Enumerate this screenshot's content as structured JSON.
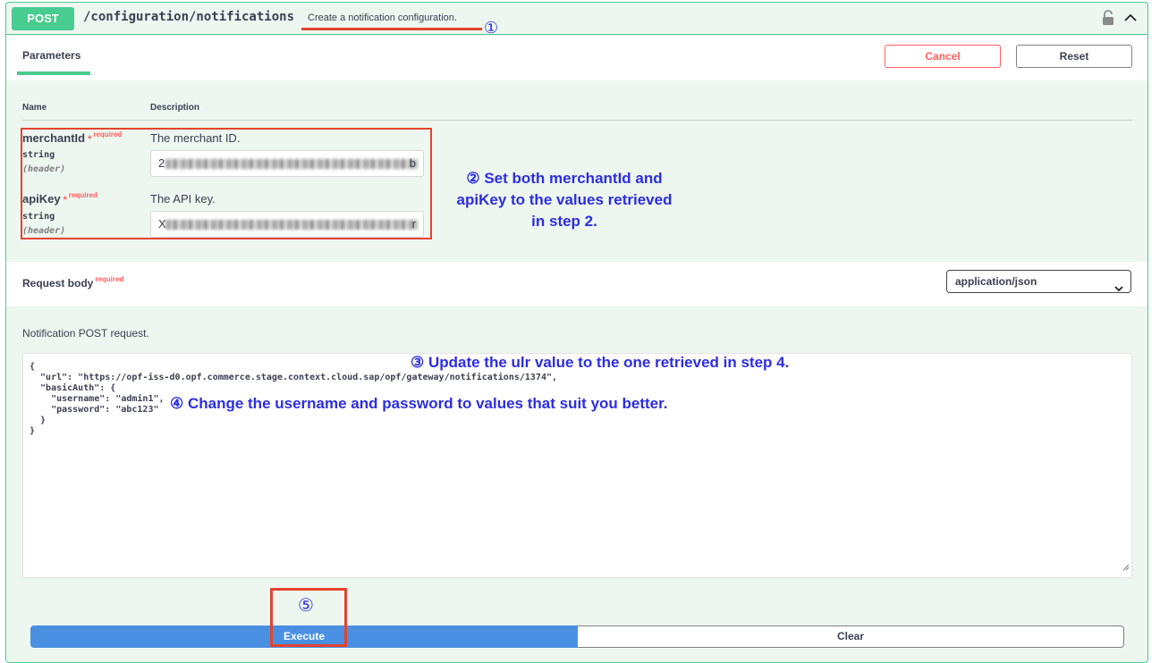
{
  "operation": {
    "method": "POST",
    "path": "/configuration/notifications",
    "summary": "Create a notification configuration."
  },
  "parameters_tab": {
    "label": "Parameters",
    "cancel_label": "Cancel",
    "reset_label": "Reset",
    "column_name": "Name",
    "column_description": "Description"
  },
  "params": [
    {
      "name": "merchantId",
      "required_star": "*",
      "required_label": "required",
      "type": "string",
      "in": "(header)",
      "description": "The merchant ID.",
      "value_start": "2",
      "value_end": "b"
    },
    {
      "name": "apiKey",
      "required_star": "*",
      "required_label": "required",
      "type": "string",
      "in": "(header)",
      "description": "The API key.",
      "value_start": "X",
      "value_end": "r"
    }
  ],
  "request_body": {
    "title": "Request body",
    "required_label": "required",
    "content_type": "application/json",
    "description": "Notification POST request.",
    "code_lines": [
      "{",
      "  \"url\": \"https://opf-iss-d0.opf.commerce.stage.context.cloud.sap/opf/gateway/notifications/1374\",",
      "  \"basicAuth\": {",
      "    \"username\": \"admin1\",",
      "    \"password\": \"abc123\"",
      "  }",
      "}"
    ]
  },
  "actions": {
    "execute_label": "Execute",
    "clear_label": "Clear"
  },
  "annotations": {
    "marker_1": "①",
    "note_2_line1": "② Set both merchantId and",
    "note_2_line2": "apiKey to the values retrieved",
    "note_2_line3": "in step 2.",
    "note_3": "③  Update the ulr value to the one retrieved in step 4.",
    "note_4": "④ Change the username and password to values that suit you better.",
    "marker_5": "⑤"
  },
  "colors": {
    "post_green": "#49cc90",
    "panel_bg": "#edf6ef",
    "cancel_red": "#ff6060",
    "execute_blue": "#4990e2",
    "annotation_blue": "#2c2ee0",
    "annotation_box_red": "#e5432f"
  },
  "icons": {
    "lock": "lock-icon",
    "collapse": "chevron-up-icon",
    "select": "chevron-down-icon",
    "resize": "resize-handle-icon"
  }
}
